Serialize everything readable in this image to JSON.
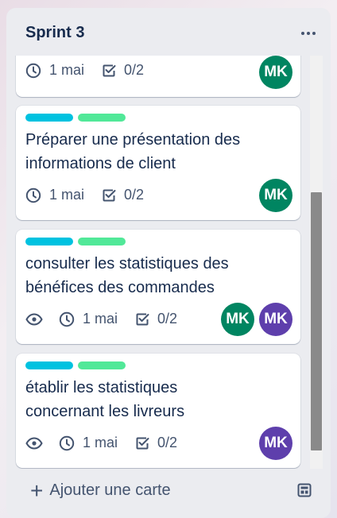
{
  "list": {
    "title": "Sprint 3",
    "more_icon": "ellipsis-icon",
    "add_card_label": "Ajouter une carte",
    "template_icon": "card-template-icon"
  },
  "colors": {
    "label_cyan": "#00c2e0",
    "label_green": "#51e898",
    "avatar_green": "#008561",
    "avatar_purple": "#5e3fac"
  },
  "cards": [
    {
      "title": "",
      "date": "1 mai",
      "checklist": "0/2",
      "avatars": [
        "MK"
      ]
    },
    {
      "title": "Préparer une présentation des informations de client",
      "date": "1 mai",
      "checklist": "0/2",
      "avatars": [
        "MK"
      ]
    },
    {
      "title": "consulter les statistiques des bénéfices des commandes",
      "date": "1 mai",
      "checklist": "0/2",
      "avatars": [
        "MK",
        "MK"
      ]
    },
    {
      "title": "établir les statistiques concernant les livreurs",
      "date": "1 mai",
      "checklist": "0/2",
      "avatars": [
        "MK"
      ]
    }
  ]
}
